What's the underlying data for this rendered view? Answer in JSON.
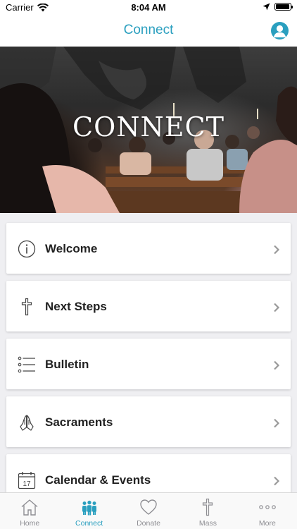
{
  "status_bar": {
    "carrier": "Carrier",
    "time": "8:04 AM",
    "battery_level": 0.95
  },
  "nav": {
    "title": "Connect"
  },
  "hero": {
    "title": "CONNECT"
  },
  "menu": {
    "items": [
      {
        "label": "Welcome",
        "icon": "info-icon"
      },
      {
        "label": "Next Steps",
        "icon": "cross-icon"
      },
      {
        "label": "Bulletin",
        "icon": "list-icon"
      },
      {
        "label": "Sacraments",
        "icon": "praying-hands-icon"
      },
      {
        "label": "Calendar & Events",
        "icon": "calendar-icon",
        "icon_text": "17"
      }
    ]
  },
  "tabs": [
    {
      "label": "Home",
      "icon": "home-icon",
      "active": false
    },
    {
      "label": "Connect",
      "icon": "people-icon",
      "active": true
    },
    {
      "label": "Donate",
      "icon": "heart-icon",
      "active": false
    },
    {
      "label": "Mass",
      "icon": "cross-icon",
      "active": false
    },
    {
      "label": "More",
      "icon": "more-icon",
      "active": false
    }
  ],
  "colors": {
    "accent": "#2a9fbf",
    "inactive": "#8e8e93"
  }
}
